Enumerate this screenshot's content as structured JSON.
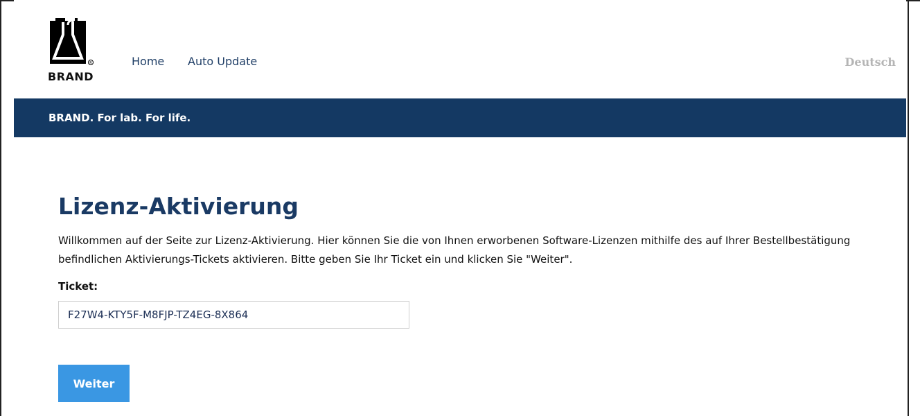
{
  "header": {
    "logo_text": "BRAND",
    "nav": [
      {
        "label": "Home"
      },
      {
        "label": "Auto Update"
      }
    ],
    "language": "Deutsch"
  },
  "banner": {
    "tagline": "BRAND. For lab. For life."
  },
  "main": {
    "title": "Lizenz-Aktivierung",
    "intro": "Willkommen auf der Seite zur Lizenz-Aktivierung. Hier können Sie die von Ihnen erworbenen Software-Lizenzen mithilfe des auf Ihrer Bestellbestätigung befindlichen Aktivierungs-Tickets aktivieren. Bitte geben Sie Ihr Ticket ein und klicken Sie \"Weiter\".",
    "ticket_label": "Ticket:",
    "ticket_value": "F27W4-KTY5F-M8FJP-TZ4EG-8X864",
    "submit_label": "Weiter"
  },
  "colors": {
    "brand_navy": "#143963",
    "heading": "#1a3a64",
    "button": "#3a97e3",
    "language_link": "#b5b5b5"
  }
}
